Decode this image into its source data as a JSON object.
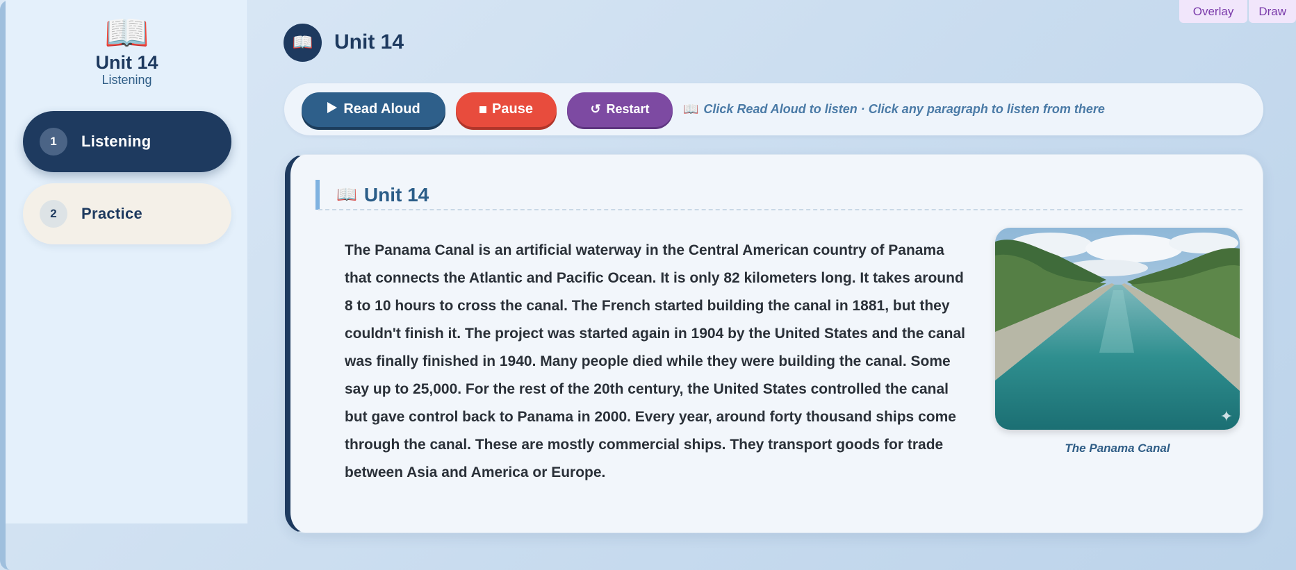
{
  "sidebar": {
    "brand_icon": "open-book-icon",
    "title": "Unit 14",
    "subtitle": "Listening",
    "items": [
      {
        "number": "1",
        "label": "Listening",
        "active": true
      },
      {
        "number": "2",
        "label": "Practice",
        "active": false
      }
    ]
  },
  "top_toggles": {
    "overlay": "Overlay",
    "draw": "Draw"
  },
  "header": {
    "title": "Unit 14",
    "icon": "open-book-icon"
  },
  "toolbar": {
    "read_aloud": "Read Aloud",
    "read_aloud_icon": "play-icon",
    "pause": "Pause",
    "pause_icon": "stop-square-icon",
    "restart": "Restart",
    "restart_icon": "restart-icon",
    "hint": "Click Read Aloud to listen · Click any paragraph to listen from there"
  },
  "card": {
    "heading": "Unit 14",
    "passage": "The Panama Canal is an artificial waterway in the Central American country of Panama that connects the Atlantic and Pacific Ocean. It is only 82 kilometers long. It takes around 8 to 10 hours to cross the canal. The French started building the canal in 1881, but they couldn't finish it. The project was started again in 1904 by the United States and the canal was finally finished in 1940. Many people died while they were building the canal. Some say up to 25,000. For the rest of the 20th century, the United States controlled the canal but gave control back to Panama in 2000. Every year, around forty thousand ships come through the canal. These are mostly commercial ships. They transport goods for trade between Asia and America or Europe.",
    "image_caption": "The Panama Canal"
  },
  "colors": {
    "navy": "#1e3a5f",
    "read_aloud": "#2e5f8a",
    "pause": "#e84c3d",
    "restart": "#7d4aa2",
    "hint": "#4a7aa6"
  }
}
